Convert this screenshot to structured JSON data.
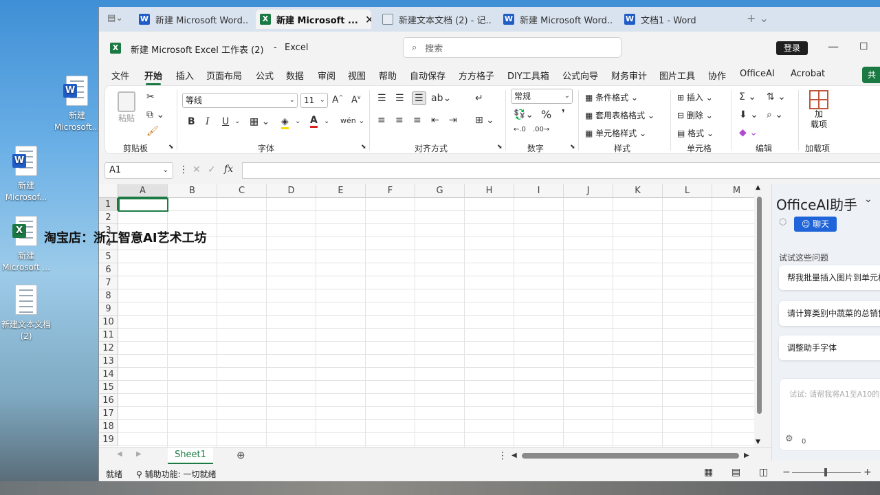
{
  "desktop": {
    "icons": [
      {
        "label": "新建 Microsoft...",
        "type": "word"
      },
      {
        "label": "新建 Microsof...",
        "type": "word"
      },
      {
        "label": "新建 Microsoft ...",
        "type": "excel"
      },
      {
        "label": "新建文本文档 (2)",
        "type": "text"
      }
    ],
    "overlay_text": "淘宝店：浙江智意AI艺术工坊"
  },
  "tabs": [
    {
      "label": "新建 Microsoft Word...",
      "app": "word"
    },
    {
      "label": "新建 Microsoft ...",
      "app": "excel",
      "active": true
    },
    {
      "label": "新建文本文档 (2) - 记...",
      "app": "notepad"
    },
    {
      "label": "新建 Microsoft Word...",
      "app": "word"
    },
    {
      "label": "文档1 - Word",
      "app": "word"
    }
  ],
  "title": {
    "doc": "新建 Microsoft Excel 工作表 (2)",
    "app": "Excel",
    "search_placeholder": "搜索",
    "login": "登录"
  },
  "menu": [
    "文件",
    "开始",
    "插入",
    "页面布局",
    "公式",
    "数据",
    "审阅",
    "视图",
    "帮助",
    "自动保存",
    "方方格子",
    "DIY工具箱",
    "公式向导",
    "财务审计",
    "图片工具",
    "协作",
    "OfficeAI",
    "Acrobat"
  ],
  "menu_selected": "开始",
  "share_label": "共",
  "ribbon": {
    "clipboard": {
      "paste": "粘贴",
      "group": "剪贴板"
    },
    "font": {
      "name": "等线",
      "size": "11",
      "group": "字体",
      "bold": "B",
      "italic": "I",
      "underline": "U"
    },
    "align": {
      "group": "对齐方式"
    },
    "number": {
      "format": "常规",
      "group": "数字",
      "percent": "%"
    },
    "styles": {
      "cond": "条件格式",
      "table": "套用表格格式",
      "cell": "单元格样式",
      "group": "样式"
    },
    "cells": {
      "insert": "插入",
      "delete": "删除",
      "format": "格式",
      "group": "单元格"
    },
    "edit": {
      "group": "编辑"
    },
    "addins": {
      "btn": "加\n载项",
      "group": "加载项"
    }
  },
  "formula": {
    "namebox": "A1",
    "fx": "fx",
    "value": ""
  },
  "columns": [
    "A",
    "B",
    "C",
    "D",
    "E",
    "F",
    "G",
    "H",
    "I",
    "J",
    "K",
    "L",
    "M"
  ],
  "rows": [
    "1",
    "2",
    "3",
    "4",
    "5",
    "6",
    "7",
    "8",
    "9",
    "10",
    "11",
    "12",
    "13",
    "14",
    "15",
    "16",
    "17",
    "18",
    "19"
  ],
  "sheet": {
    "name": "Sheet1"
  },
  "status": {
    "ready": "就绪",
    "accessibility": "辅助功能: 一切就绪"
  },
  "panel": {
    "title": "OfficeAI助手",
    "chat": "聊天",
    "suggest_heading": "试试这些问题",
    "suggestions": [
      "帮我批量插入图片到单元格",
      "请计算类别中蔬菜的总销售",
      "调整助手字体"
    ],
    "input_placeholder": "试试: 请帮我将A1至A10的",
    "counter": "0"
  },
  "colors": {
    "excel_green": "#1b7a43",
    "word_blue": "#1f5cc6",
    "chat_blue": "#1f64d8"
  }
}
